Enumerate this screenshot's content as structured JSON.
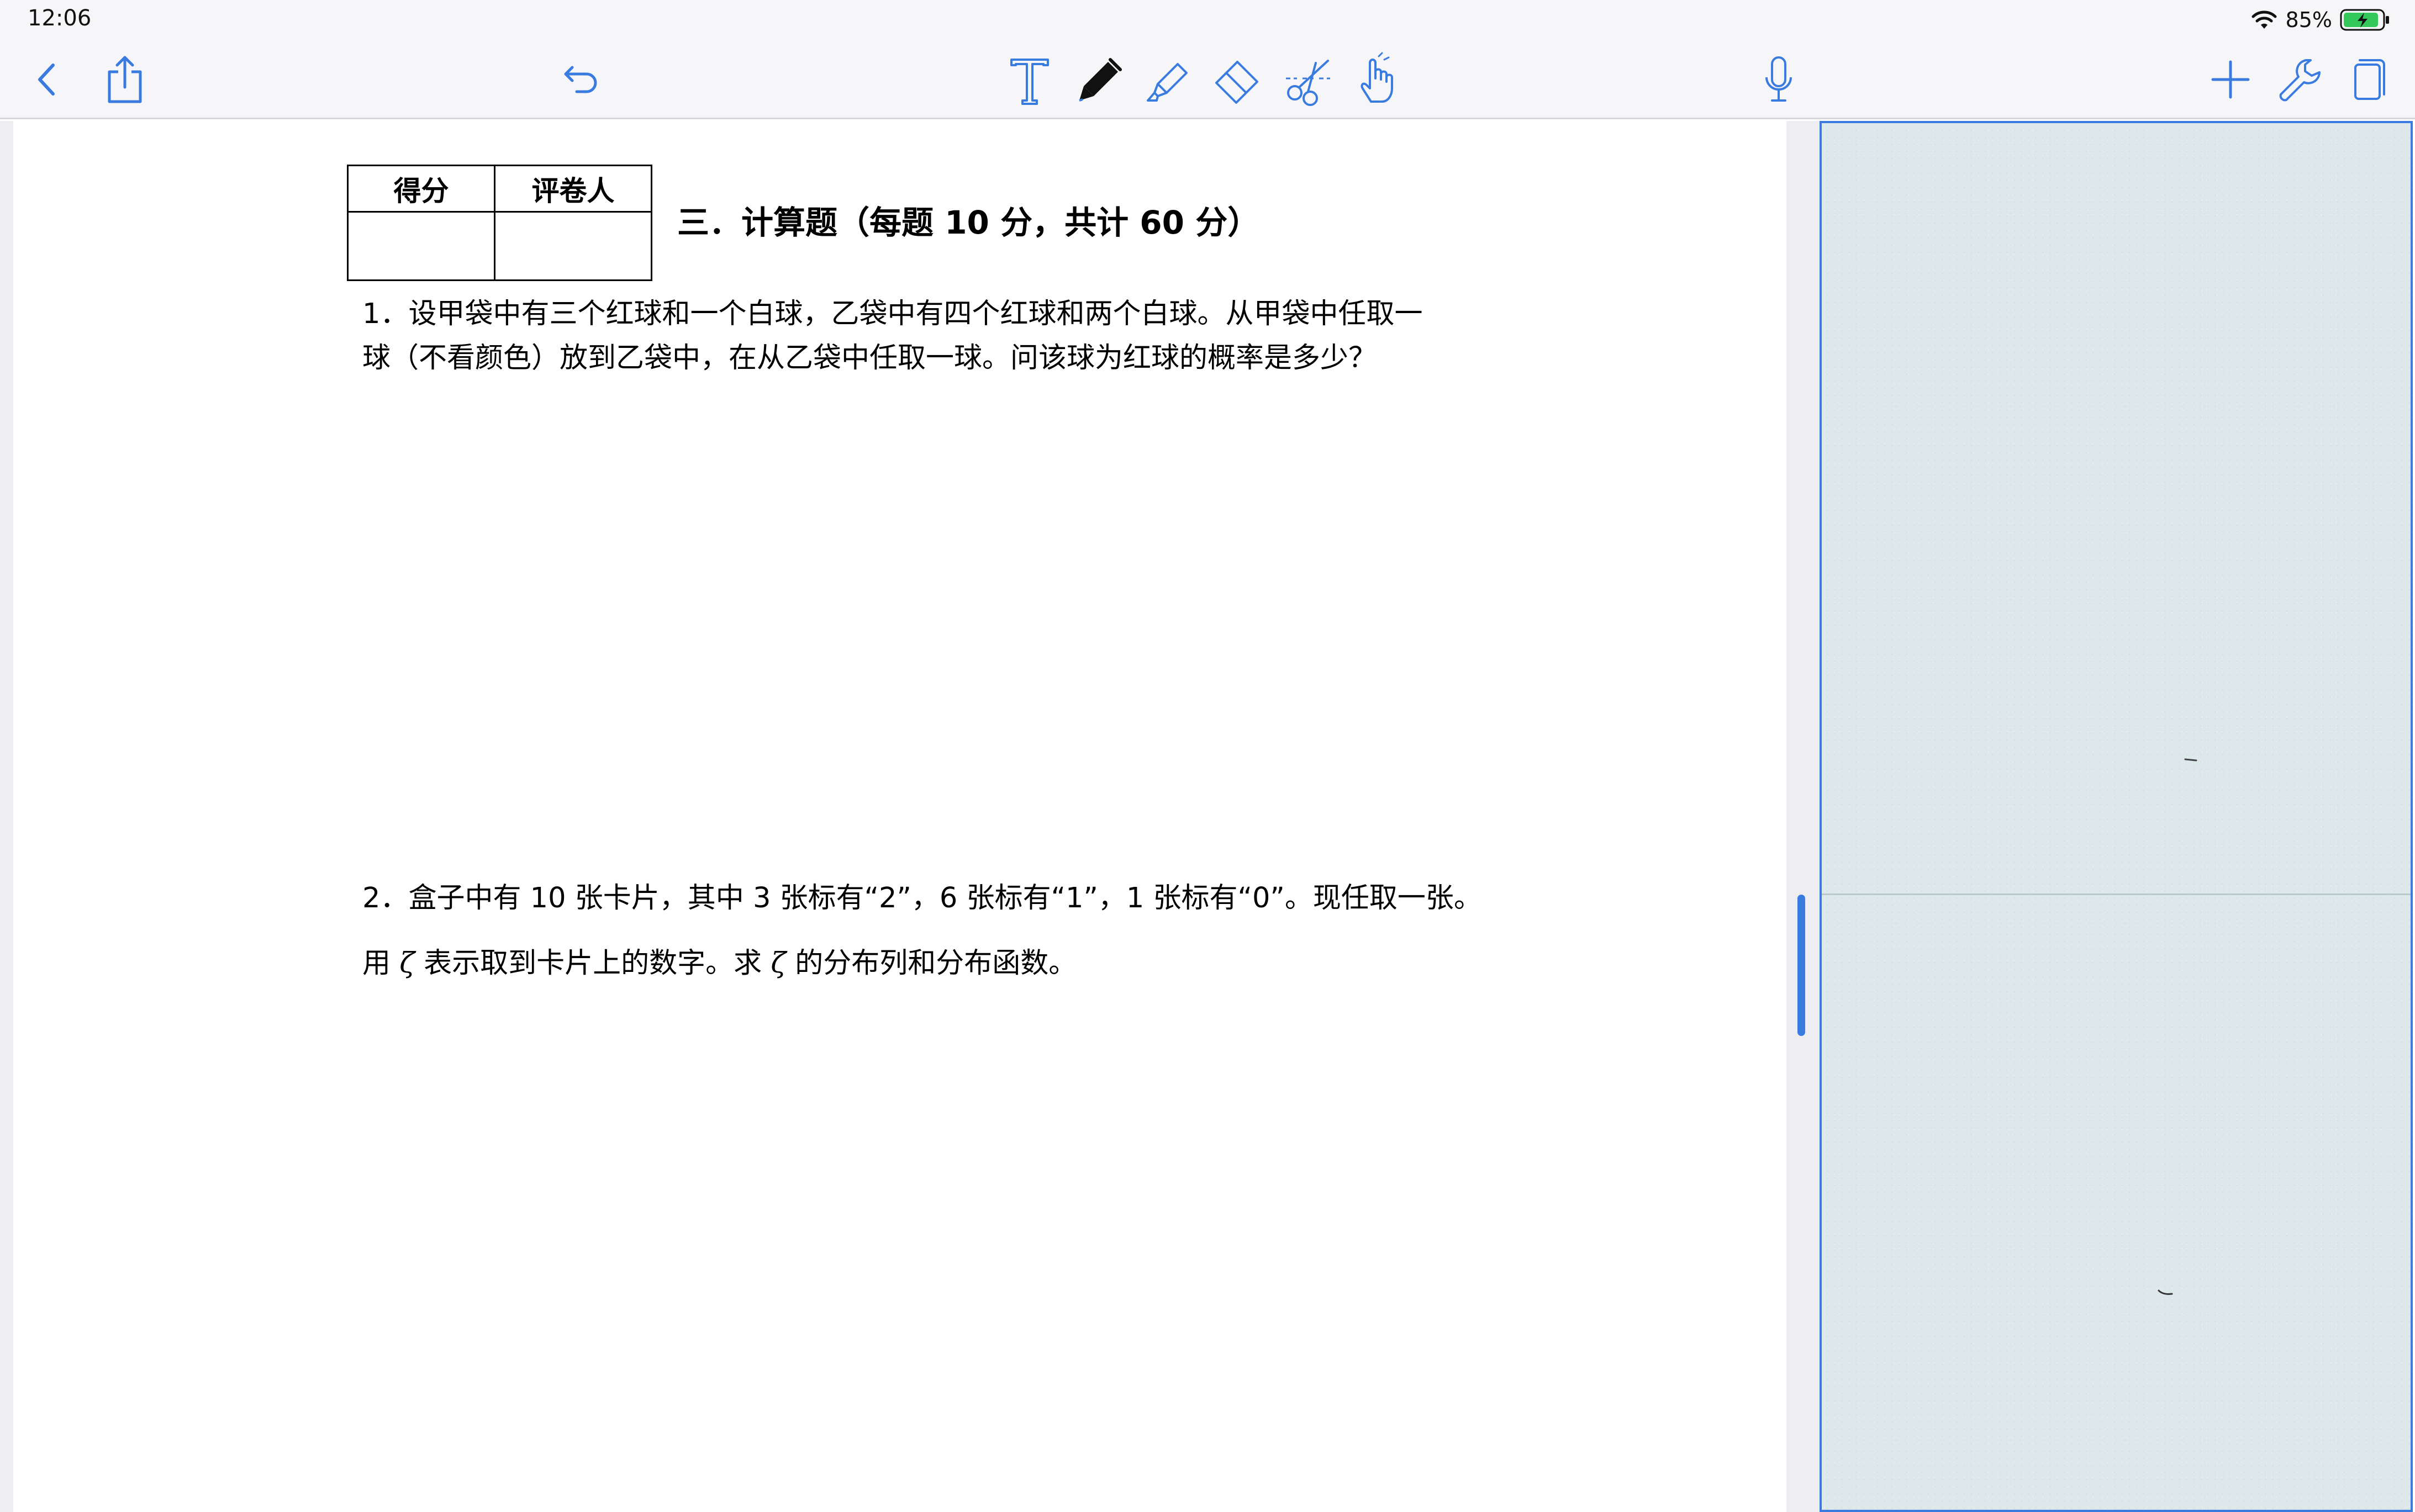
{
  "status_bar": {
    "time": "12:06",
    "battery_percent": "85%",
    "battery_charging": true
  },
  "toolbar": {
    "left_tools": [
      "back-icon",
      "share-icon",
      "undo-icon"
    ],
    "center_tools": [
      "text-tool-icon",
      "pen-tool-icon",
      "highlighter-tool-icon",
      "eraser-tool-icon",
      "scissors-tool-icon",
      "hand-tool-icon"
    ],
    "selected_tool": "pen-tool-icon",
    "right_tools": [
      "microphone-icon",
      "add-icon",
      "wrench-icon",
      "pages-icon"
    ],
    "accent_color": "#3a7be0"
  },
  "exam": {
    "score_table": {
      "headers": [
        "得分",
        "评卷人"
      ]
    },
    "section_title": "三．计算题（每题 10 分，共计 60 分）",
    "q1": {
      "line1": "1．设甲袋中有三个红球和一个白球，乙袋中有四个红球和两个白球。从甲袋中任取一",
      "line2": "球（不看颜色）放到乙袋中，在从乙袋中任取一球。问该球为红球的概率是多少？"
    },
    "q2": {
      "line1": "2．盒子中有 10 张卡片，其中 3 张标有“2”，6 张标有“1”，1 张标有“0”。现任取一张。",
      "line2_a": "用",
      "symbol": "ζ",
      "line2_b": "表示取到卡片上的数字。求",
      "line2_c": "的分布列和分布函数。"
    }
  }
}
